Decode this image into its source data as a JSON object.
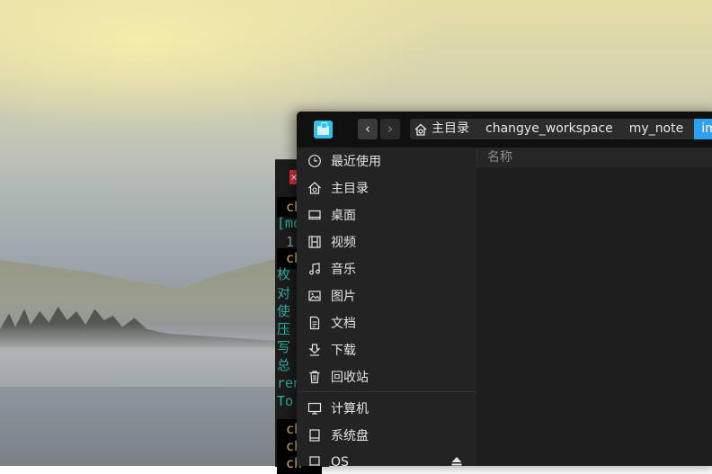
{
  "file_manager": {
    "back_glyph": "‹",
    "forward_glyph": "›",
    "breadcrumbs": [
      "主目录",
      "changye_workspace",
      "my_note",
      "img"
    ],
    "column_header": "名称",
    "sidebar": [
      {
        "label": "最近使用",
        "icon": "clock-icon"
      },
      {
        "label": "主目录",
        "icon": "home-icon"
      },
      {
        "label": "桌面",
        "icon": "desktop-icon"
      },
      {
        "label": "视频",
        "icon": "video-icon"
      },
      {
        "label": "音乐",
        "icon": "music-icon"
      },
      {
        "label": "图片",
        "icon": "picture-icon"
      },
      {
        "label": "文档",
        "icon": "document-icon"
      },
      {
        "label": "下载",
        "icon": "download-icon"
      },
      {
        "label": "回收站",
        "icon": "trash-icon"
      },
      {
        "label": "计算机",
        "icon": "computer-icon"
      },
      {
        "label": "系统盘",
        "icon": "disk-icon"
      },
      {
        "label": "OS",
        "icon": "disk-icon"
      }
    ],
    "accent": "#2ea0f0"
  },
  "terminal": {
    "close_glyph": "×",
    "lines": [
      "ch",
      "[mo",
      "1",
      "ch",
      "枚",
      "对",
      "使",
      "压",
      "写",
      "总",
      "ren",
      "To",
      "ch",
      "ch",
      "ch"
    ]
  }
}
